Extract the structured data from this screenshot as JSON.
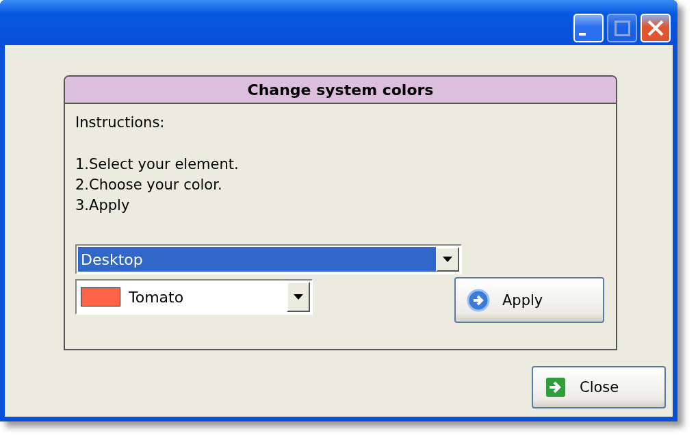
{
  "window": {
    "title_buttons": [
      {
        "kind": "minimize",
        "disabled": false
      },
      {
        "kind": "maximize",
        "disabled": true
      },
      {
        "kind": "close",
        "disabled": false
      }
    ]
  },
  "panel": {
    "title": "Change system colors",
    "instructions": [
      "Instructions:",
      "1.Select your element.",
      "2.Choose your color.",
      "3.Apply"
    ],
    "element_dropdown": {
      "value": "Desktop",
      "selected": true
    },
    "color_dropdown": {
      "value": "Tomato",
      "color": "#ff6347",
      "selected": false
    },
    "apply_button": {
      "label": "Apply"
    }
  },
  "close_button": {
    "label": "Close"
  }
}
